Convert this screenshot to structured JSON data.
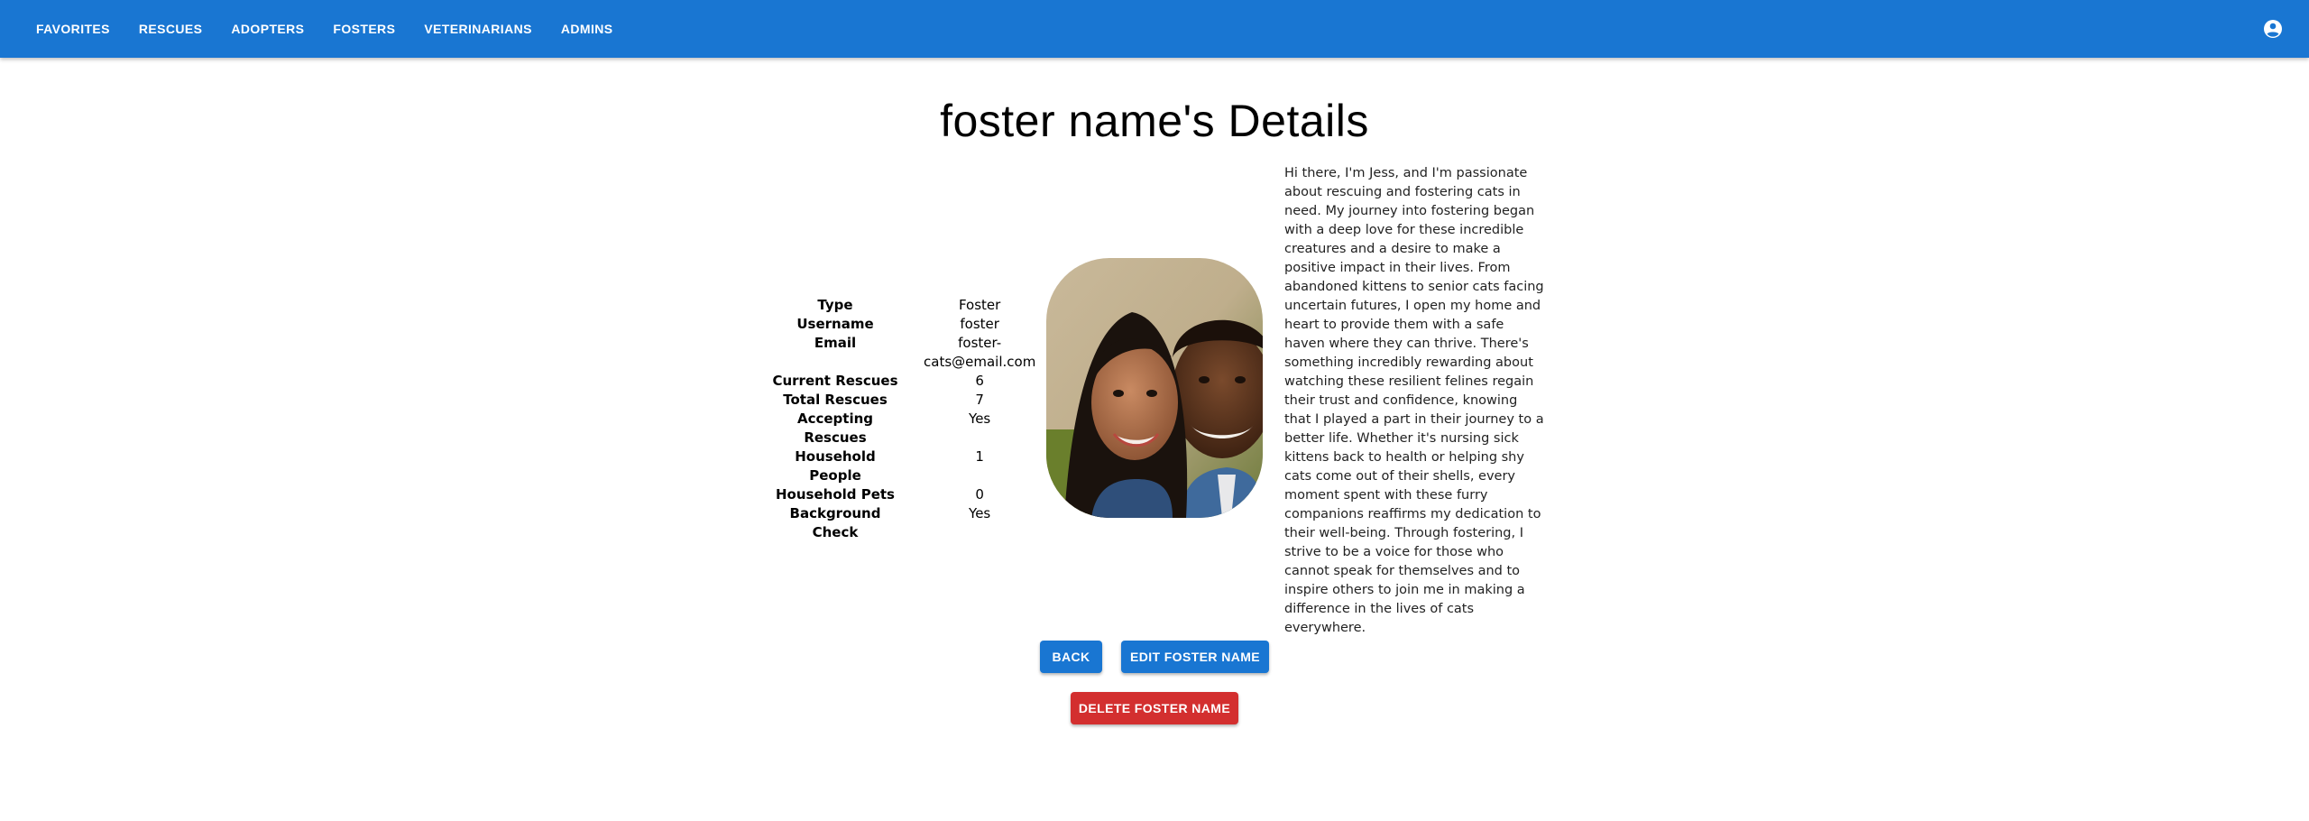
{
  "nav": {
    "items": [
      "FAVORITES",
      "RESCUES",
      "ADOPTERS",
      "FOSTERS",
      "VETERINARIANS",
      "ADMINS"
    ],
    "account_icon": "account-circle-icon"
  },
  "page": {
    "title": "foster name's Details"
  },
  "details": {
    "rows": [
      {
        "label": "Type",
        "value": "Foster"
      },
      {
        "label": "Username",
        "value": "foster"
      },
      {
        "label": "Email",
        "value": "foster-cats@email.com"
      },
      {
        "label": "Current Rescues",
        "value": "6"
      },
      {
        "label": "Total Rescues",
        "value": "7"
      },
      {
        "label": "Accepting Rescues",
        "value": "Yes"
      },
      {
        "label": "Household People",
        "value": "1"
      },
      {
        "label": "Household Pets",
        "value": "0"
      },
      {
        "label": "Background Check",
        "value": "Yes"
      }
    ]
  },
  "bio": "Hi there, I'm Jess, and I'm passionate about rescuing and fostering cats in need. My journey into fostering began with a deep love for these incredible creatures and a desire to make a positive impact in their lives. From abandoned kittens to senior cats facing uncertain futures, I open my home and heart to provide them with a safe haven where they can thrive. There's something incredibly rewarding about watching these resilient felines regain their trust and confidence, knowing that I played a part in their journey to a better life. Whether it's nursing sick kittens back to health or helping shy cats come out of their shells, every moment spent with these furry companions reaffirms my dedication to their well-being. Through fostering, I strive to be a voice for those who cannot speak for themselves and to inspire others to join me in making a difference in the lives of cats everywhere.",
  "actions": {
    "back": "BACK",
    "edit": "EDIT FOSTER NAME",
    "delete": "DELETE FOSTER NAME"
  },
  "colors": {
    "primary": "#1976d2",
    "danger": "#d32f2f"
  }
}
